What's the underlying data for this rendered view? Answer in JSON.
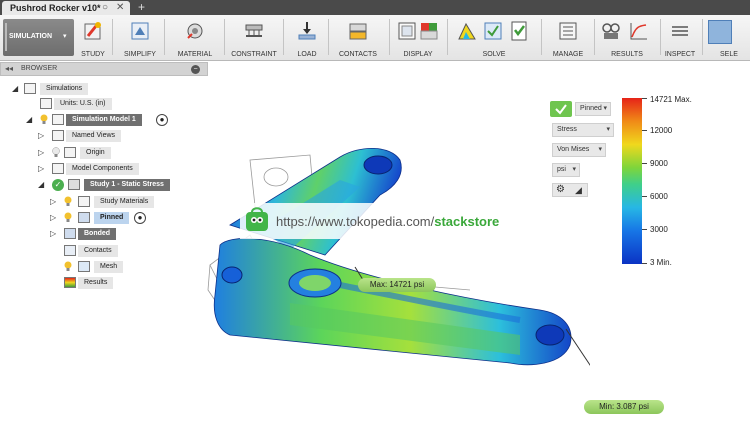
{
  "document": {
    "tab_title": "Pushrod Rocker v10*"
  },
  "toolbar": {
    "workspace": "SIMULATION",
    "groups": [
      {
        "label": "STUDY"
      },
      {
        "label": "SIMPLIFY"
      },
      {
        "label": "MATERIAL"
      },
      {
        "label": "CONSTRAINT"
      },
      {
        "label": "LOAD"
      },
      {
        "label": "CONTACTS"
      },
      {
        "label": "DISPLAY"
      },
      {
        "label": "SOLVE"
      },
      {
        "label": "MANAGE"
      },
      {
        "label": "RESULTS"
      },
      {
        "label": "INSPECT"
      },
      {
        "label": "SELE"
      }
    ]
  },
  "browser": {
    "title": "BROWSER",
    "tree": [
      {
        "label": "Simulations"
      },
      {
        "label": "Units: U.S. (in)"
      },
      {
        "label": "Simulation Model 1"
      },
      {
        "label": "Named Views"
      },
      {
        "label": "Origin"
      },
      {
        "label": "Model Components"
      },
      {
        "label": "Study 1 - Static Stress"
      },
      {
        "label": "Study Materials"
      },
      {
        "label": "Pinned"
      },
      {
        "label": "Bonded"
      },
      {
        "label": "Contacts"
      },
      {
        "label": "Mesh"
      },
      {
        "label": "Results"
      }
    ]
  },
  "legend": {
    "dropdowns": [
      "Pinned",
      "Stress",
      "Von Mises",
      "psi"
    ],
    "scale": {
      "max": "14721 Max.",
      "ticks": [
        "12000",
        "9000",
        "6000",
        "3000"
      ],
      "min": "3 Min."
    },
    "colors": [
      "#e62318",
      "#f08a17",
      "#f0d81d",
      "#7ed53b",
      "#3fcf8a",
      "#27b7e5",
      "#1776e6",
      "#0b33c4"
    ]
  },
  "viewport": {
    "max_callout": "Max: 14721 psi",
    "min_callout": "Min: 3.087 psi"
  },
  "watermark": {
    "prefix": "https://www.tokopedia.com/",
    "brand": "stackstore"
  },
  "colors": {
    "accent_green": "#8cc65b",
    "selection_blue": "#bcd4ee"
  }
}
